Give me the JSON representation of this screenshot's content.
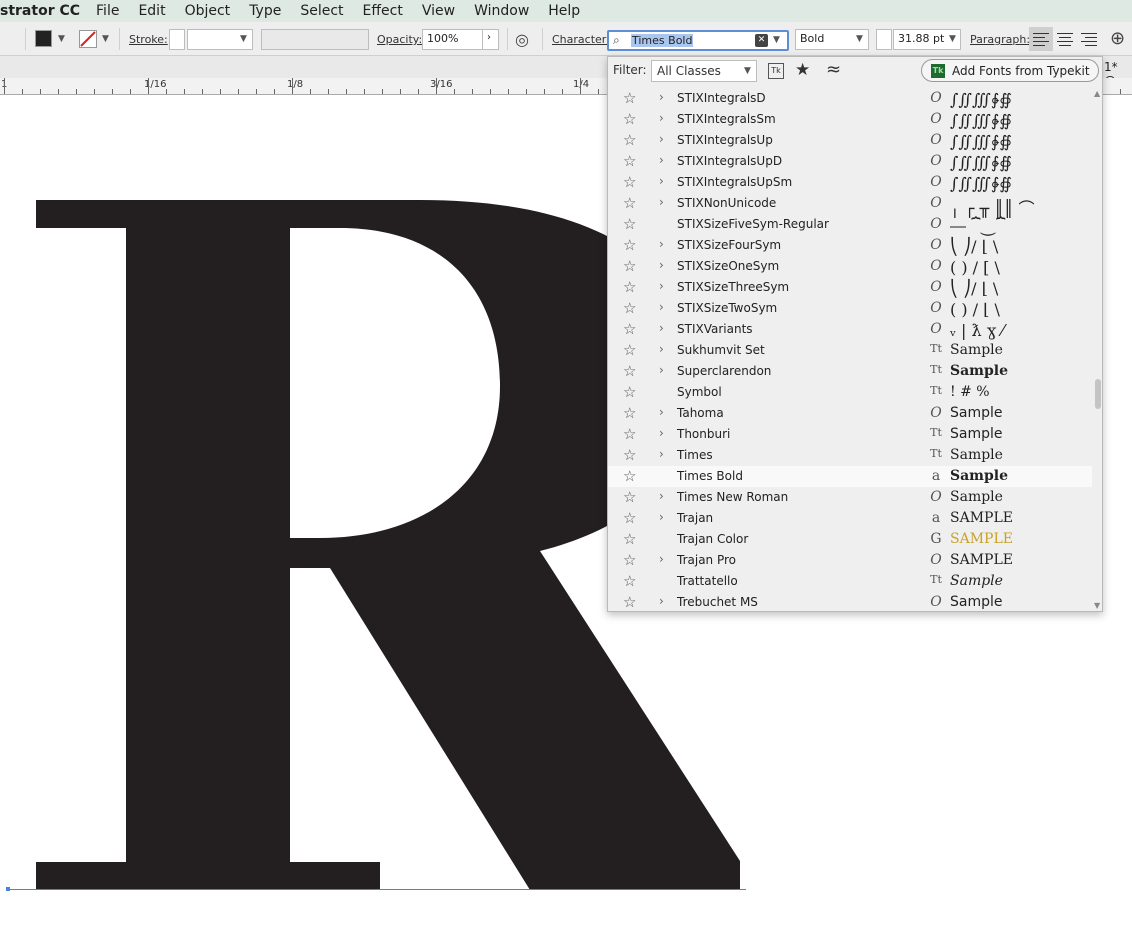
{
  "menubar": {
    "app": "strator CC",
    "items": [
      "File",
      "Edit",
      "Object",
      "Type",
      "Select",
      "Effect",
      "View",
      "Window",
      "Help"
    ]
  },
  "control": {
    "stroke_label": "Stroke:",
    "opacity_label": "Opacity:",
    "opacity_value": "100%",
    "character_label": "Character:",
    "font_value": "Times Bold",
    "style_value": "Bold",
    "size_value": "31.88 pt",
    "paragraph_label": "Paragraph:",
    "doc_tab": "1* @"
  },
  "ruler": {
    "labels": [
      "1",
      "1/16",
      "1/8",
      "3/16",
      "1/4"
    ]
  },
  "canvas": {
    "letter": "R",
    "letter_color": "#231f20"
  },
  "fontmenu": {
    "filter_label": "Filter:",
    "filter_value": "All Classes",
    "typekit_icon": "Tk",
    "typekit_label": "Add Fonts from Typekit",
    "fonts": [
      {
        "name": "STIXIntegralsD",
        "expand": true,
        "icon": "O",
        "sample": "∫∬∭∲∯"
      },
      {
        "name": "STIXIntegralsSm",
        "expand": true,
        "icon": "O",
        "sample": "∫∬∭∲∯"
      },
      {
        "name": "STIXIntegralsUp",
        "expand": true,
        "icon": "O",
        "sample": "∫∬∭∲∯"
      },
      {
        "name": "STIXIntegralsUpD",
        "expand": true,
        "icon": "O",
        "sample": "∫∬∭∲∯"
      },
      {
        "name": "STIXIntegralsUpSm",
        "expand": true,
        "icon": "O",
        "sample": "∫∬∭∲∯"
      },
      {
        "name": "STIXNonUnicode",
        "expand": true,
        "icon": "O",
        "sample": "╷ ┌ ╥ ║║ ⌒"
      },
      {
        "name": "STIXSizeFiveSym-Regular",
        "expand": false,
        "icon": "O",
        "sample": "⎯⎯ ⏞⏝⏞"
      },
      {
        "name": "STIXSizeFourSym",
        "expand": true,
        "icon": "O",
        "sample": "⎝ ⎠/ ⌊ \\"
      },
      {
        "name": "STIXSizeOneSym",
        "expand": true,
        "icon": "O",
        "sample": "( ) / [ \\"
      },
      {
        "name": "STIXSizeThreeSym",
        "expand": true,
        "icon": "O",
        "sample": "⎝ ⎠/ ⌊ \\"
      },
      {
        "name": "STIXSizeTwoSym",
        "expand": true,
        "icon": "O",
        "sample": "( ) / ⌊ \\"
      },
      {
        "name": "STIXVariants",
        "expand": true,
        "icon": "O",
        "sample": "ᵥ | ƛ ɣ ⁄"
      },
      {
        "name": "Sukhumvit Set",
        "expand": true,
        "icon": "Tt",
        "sample": "Sample"
      },
      {
        "name": "Superclarendon",
        "expand": true,
        "icon": "Tt",
        "sample": "Sample"
      },
      {
        "name": "Symbol",
        "expand": false,
        "icon": "Tt",
        "sample": "! # %"
      },
      {
        "name": "Tahoma",
        "expand": true,
        "icon": "O",
        "sample": "Sample"
      },
      {
        "name": "Thonburi",
        "expand": true,
        "icon": "Tt",
        "sample": "Sample"
      },
      {
        "name": "Times",
        "expand": true,
        "icon": "Tt",
        "sample": "Sample"
      },
      {
        "name": "Times Bold",
        "expand": false,
        "icon": "a",
        "sample": "Sample",
        "selected": true
      },
      {
        "name": "Times New Roman",
        "expand": true,
        "icon": "O",
        "sample": "Sample"
      },
      {
        "name": "Trajan",
        "expand": true,
        "icon": "a",
        "sample": "SAMPLE"
      },
      {
        "name": "Trajan Color",
        "expand": false,
        "icon": "G",
        "sample": "SAMPLE"
      },
      {
        "name": "Trajan Pro",
        "expand": true,
        "icon": "O",
        "sample": "SAMPLE"
      },
      {
        "name": "Trattatello",
        "expand": false,
        "icon": "Tt",
        "sample": "Sample"
      },
      {
        "name": "Trebuchet MS",
        "expand": true,
        "icon": "O",
        "sample": "Sample"
      }
    ],
    "trajan_color_sample_color": "#c9a227"
  }
}
